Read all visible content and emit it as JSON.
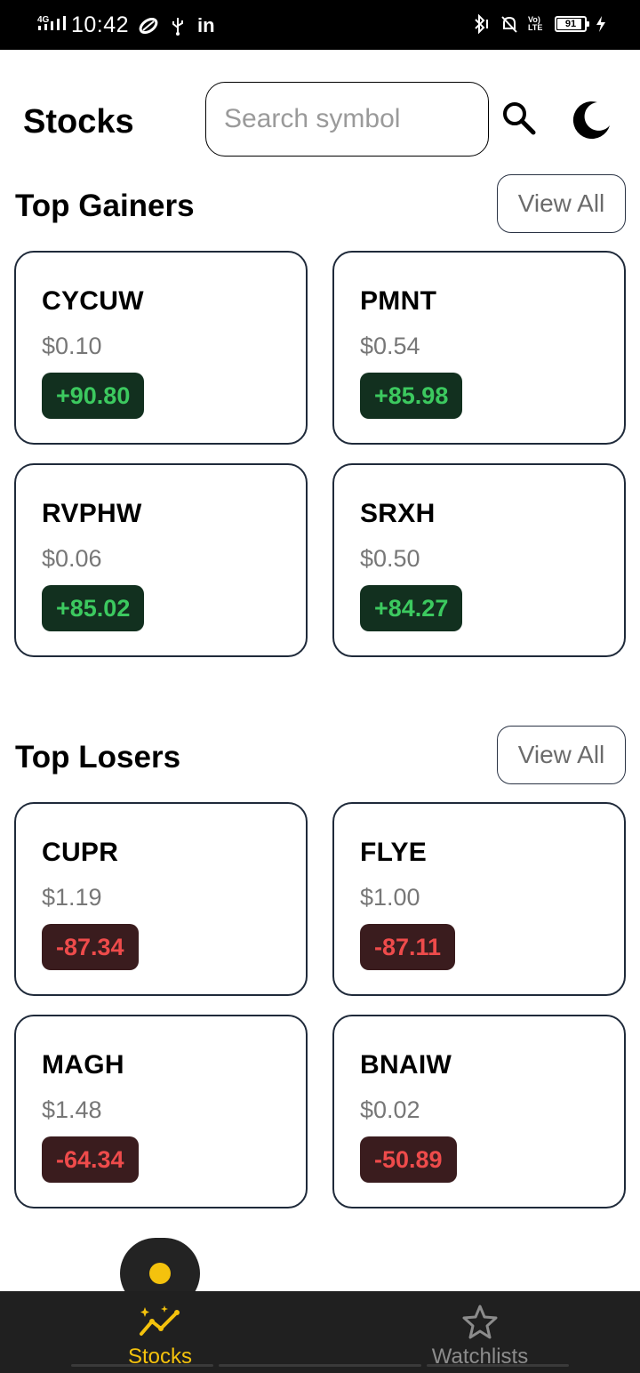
{
  "status_bar": {
    "network": "4G",
    "time": "10:42",
    "linkedin": "in",
    "lte": "Vo) LTE",
    "battery": "91",
    "battery_fraction": 0.91
  },
  "header": {
    "title": "Stocks",
    "search_placeholder": "Search symbol"
  },
  "gainers": {
    "title": "Top Gainers",
    "view_all": "View All",
    "items": [
      {
        "symbol": "CYCUW",
        "price": "$0.10",
        "change": "+90.80"
      },
      {
        "symbol": "PMNT",
        "price": "$0.54",
        "change": "+85.98"
      },
      {
        "symbol": "RVPHW",
        "price": "$0.06",
        "change": "+85.02"
      },
      {
        "symbol": "SRXH",
        "price": "$0.50",
        "change": "+84.27"
      }
    ]
  },
  "losers": {
    "title": "Top Losers",
    "view_all": "View All",
    "items": [
      {
        "symbol": "CUPR",
        "price": "$1.19",
        "change": "-87.34"
      },
      {
        "symbol": "FLYE",
        "price": "$1.00",
        "change": "-87.11"
      },
      {
        "symbol": "MAGH",
        "price": "$1.48",
        "change": "-64.34"
      },
      {
        "symbol": "BNAIW",
        "price": "$0.02",
        "change": "-50.89"
      }
    ]
  },
  "bottom_nav": {
    "items": [
      {
        "label": "Stocks",
        "icon": "trending-chart-icon",
        "active": true
      },
      {
        "label": "Watchlists",
        "icon": "star-icon",
        "active": false
      }
    ]
  },
  "colors": {
    "accent": "#f4c20d",
    "gain_text": "#3cc95f",
    "gain_bg": "#12301f",
    "loss_text": "#ee4b4b",
    "loss_bg": "#3a1c1e",
    "nav_bg": "#202020"
  }
}
